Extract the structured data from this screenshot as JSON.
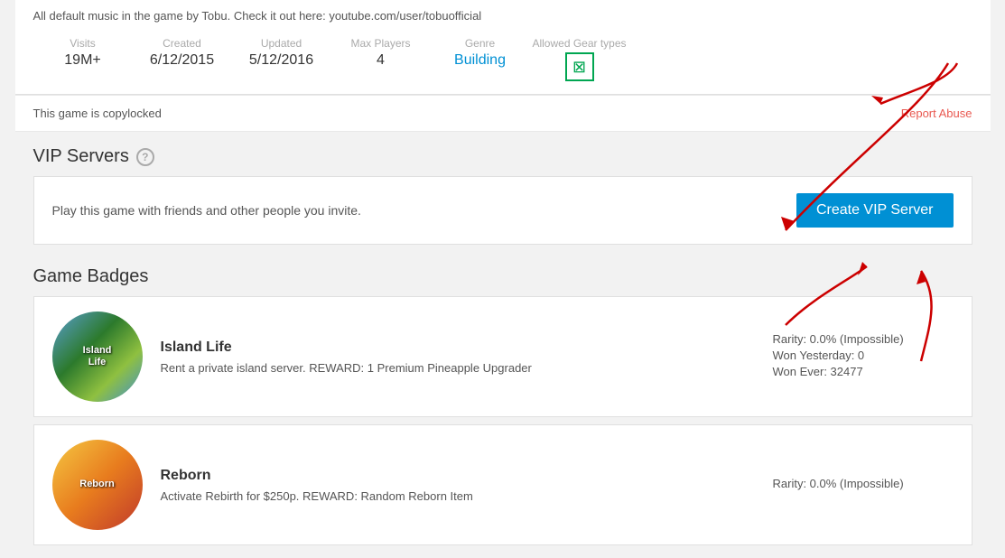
{
  "page": {
    "description": "All default music in the game by Tobu. Check it out here: youtube.com/user/tobuofficial",
    "stats": {
      "visits_label": "Visits",
      "visits_value": "19M+",
      "created_label": "Created",
      "created_value": "6/12/2015",
      "updated_label": "Updated",
      "updated_value": "5/12/2016",
      "max_players_label": "Max Players",
      "max_players_value": "4",
      "genre_label": "Genre",
      "genre_value": "Building",
      "allowed_gear_label": "Allowed Gear types"
    },
    "copylocked": "This game is copylocked",
    "report_abuse": "Report Abuse",
    "vip_servers": {
      "title": "VIP Servers",
      "help_icon": "?",
      "card_text": "Play this game with friends and other people you invite.",
      "create_button": "Create VIP Server"
    },
    "game_badges": {
      "title": "Game Badges",
      "badges": [
        {
          "name": "Island Life",
          "description": "Rent a private island server. REWARD: 1 Premium Pineapple Upgrader",
          "image_text": "Island\nLife",
          "rarity": "Rarity: 0.0% (Impossible)",
          "won_yesterday": "Won Yesterday: 0",
          "won_ever": "Won Ever: 32477"
        },
        {
          "name": "Reborn",
          "description": "Activate Rebirth for $250p. REWARD: Random Reborn Item",
          "image_text": "Reborn",
          "rarity": "Rarity: 0.0% (Impossible)",
          "won_yesterday": "",
          "won_ever": ""
        }
      ]
    }
  }
}
